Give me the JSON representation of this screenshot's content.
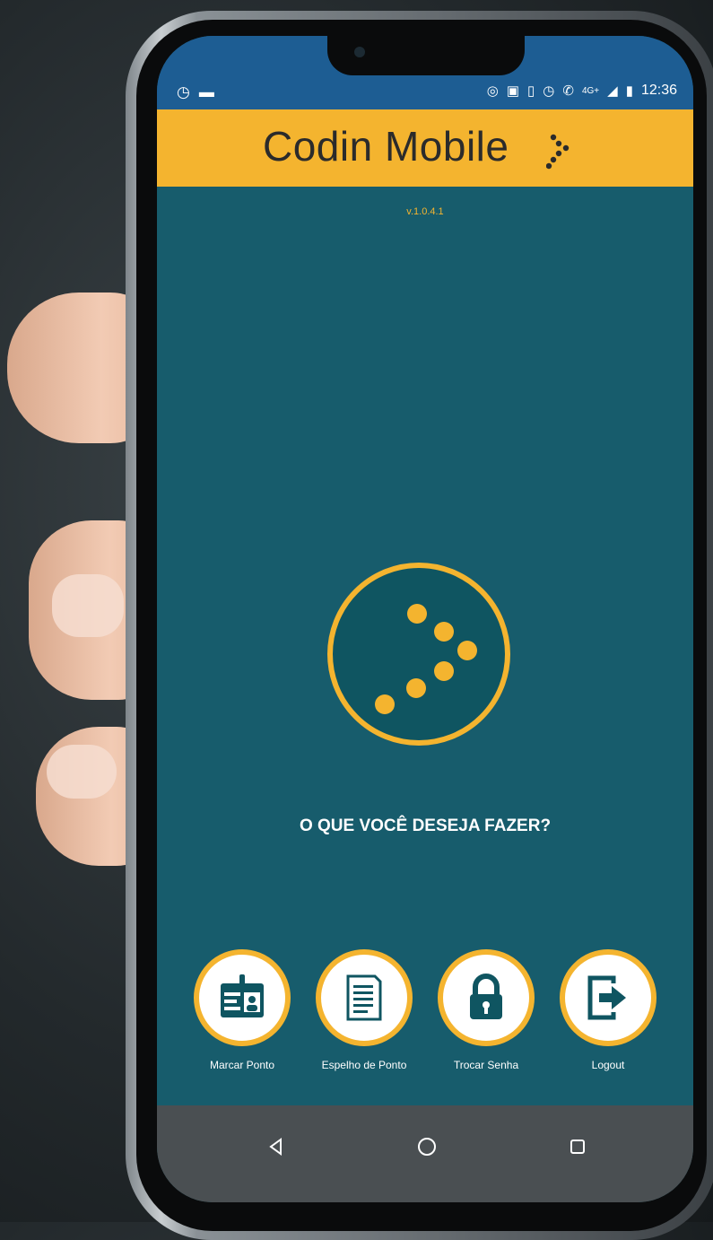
{
  "status_bar": {
    "left_icons": [
      "alarm-icon",
      "image-icon"
    ],
    "right_icons": [
      "hotspot-icon",
      "nfc-icon",
      "vibrate-icon",
      "alarm-icon",
      "call-icon",
      "signal-icon",
      "battery-icon"
    ],
    "network": "4G+",
    "time": "12:36"
  },
  "app_bar": {
    "title": "Codin Mobile"
  },
  "version": "v.1.0.4.1",
  "prompt": "O QUE VOCÊ DESEJA FAZER?",
  "actions": [
    {
      "label": "Marcar Ponto",
      "icon": "id-card-icon"
    },
    {
      "label": "Espelho de Ponto",
      "icon": "document-icon"
    },
    {
      "label": "Trocar Senha",
      "icon": "lock-icon"
    },
    {
      "label": "Logout",
      "icon": "logout-icon"
    }
  ],
  "nav_bar": {
    "buttons": [
      "back-icon",
      "home-icon",
      "recents-icon"
    ]
  },
  "colors": {
    "accent": "#f4b42f",
    "background": "#175c6c",
    "status_bar": "#1d5d93",
    "nav_bar": "#4a4f52"
  }
}
